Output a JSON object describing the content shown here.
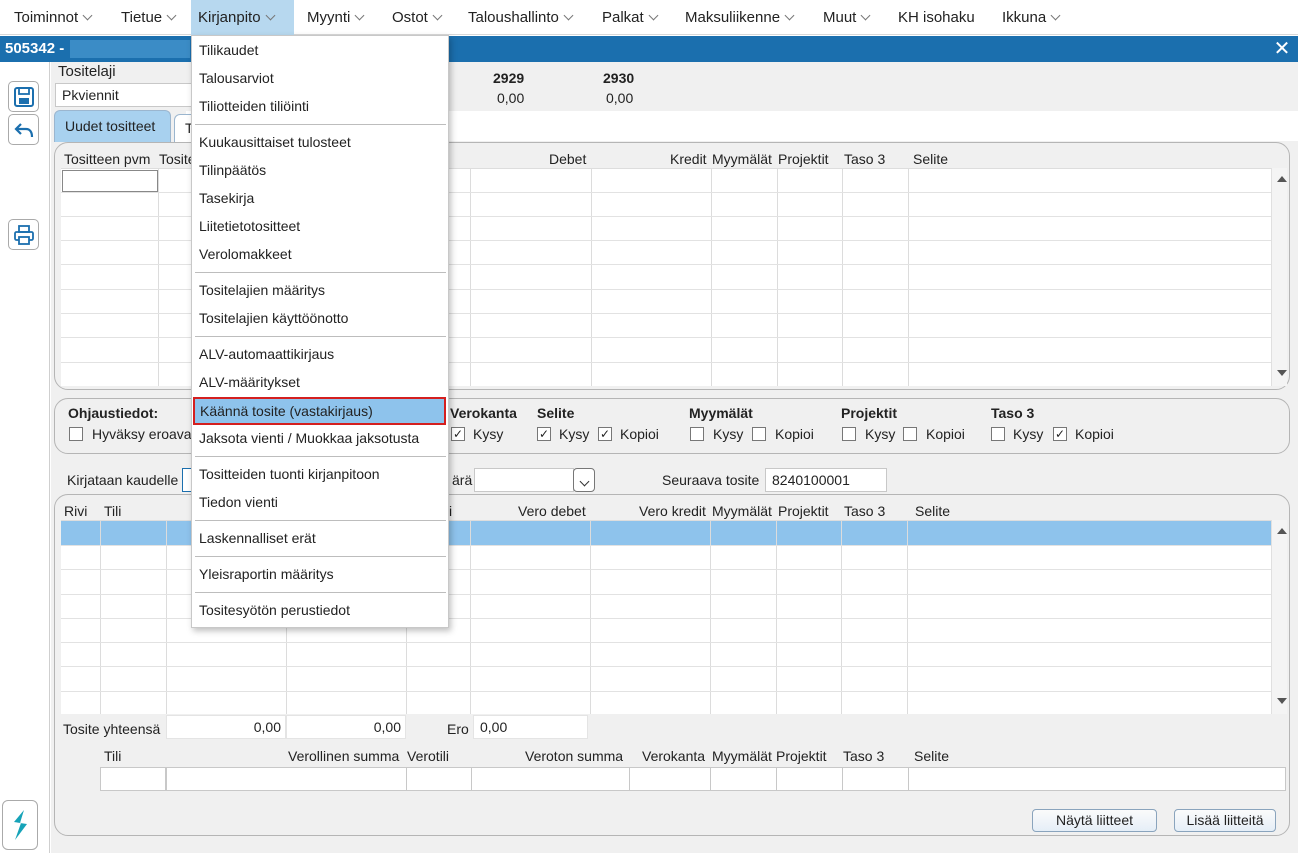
{
  "menubar": {
    "items": [
      "Toiminnot",
      "Tietue",
      "Kirjanpito",
      "Myynti",
      "Ostot",
      "Taloushallinto",
      "Palkat",
      "Maksuliikenne",
      "Muut",
      "KH isohaku",
      "Ikkuna"
    ]
  },
  "window": {
    "title": "505342 -"
  },
  "header": {
    "tositelaji_label": "Tositelaji",
    "tositelaji_value": "Pkviennit",
    "col1_head": "2929",
    "col1_val": "0,00",
    "col2_head": "2930",
    "col2_val": "0,00"
  },
  "tabs": {
    "tab1": "Uudet tositteet",
    "tab2": "T"
  },
  "grid1": {
    "headers": {
      "pvm": "Tositteen pvm",
      "tosite": "Tosite",
      "debet": "Debet",
      "kredit": "Kredit",
      "myymalat": "Myymälät",
      "projektit": "Projektit",
      "taso3": "Taso 3",
      "selite": "Selite"
    }
  },
  "ohjaus": {
    "title": "Ohjaustiedot:",
    "hyvaksy": "Hyväksy eroava",
    "verokanta": "Verokanta",
    "selite": "Selite",
    "myymalat": "Myymälät",
    "projektit": "Projektit",
    "taso3": "Taso 3",
    "kysy": "Kysy",
    "kopioi": "Kopioi"
  },
  "kirjataan": {
    "label": "Kirjataan kaudelle",
    "partial": "ärä",
    "seuraava_label": "Seuraava tosite",
    "seuraava_value": "8240100001"
  },
  "grid2": {
    "headers": {
      "rivi": "Rivi",
      "tili": "Tili",
      "i": "i",
      "vero_debet": "Vero debet",
      "vero_kredit": "Vero kredit",
      "myymalat": "Myymälät",
      "projektit": "Projektit",
      "taso3": "Taso 3",
      "selite": "Selite"
    }
  },
  "totals": {
    "label": "Tosite yhteensä",
    "debet": "0,00",
    "kredit": "0,00",
    "ero_label": "Ero",
    "ero": "0,00"
  },
  "entry": {
    "headers": {
      "tili": "Tili",
      "verollinen": "Verollinen summa",
      "verotili": "Verotili",
      "veroton": "Veroton summa",
      "verokanta": "Verokanta",
      "myymalat": "Myymälät",
      "projektit": "Projektit",
      "taso3": "Taso 3",
      "selite": "Selite"
    }
  },
  "buttons": {
    "nayta": "Näytä liitteet",
    "lisaa": "Lisää liitteitä"
  },
  "dropdown": {
    "items": [
      "Tilikaudet",
      "Talousarviot",
      "Tiliotteiden tiliöinti",
      "Kuukausittaiset tulosteet",
      "Tilinpäätös",
      "Tasekirja",
      "Liitetietotositteet",
      "Verolomakkeet",
      "Tositelajien määritys",
      "Tositelajien käyttöönotto",
      "ALV-automaattikirjaus",
      "ALV-määritykset",
      "Käännä tosite (vastakirjaus)",
      "Jaksota vienti / Muokkaa jaksotusta",
      "Tositteiden tuonti kirjanpitoon",
      "Tiedon vienti",
      "Laskennalliset erät",
      "Yleisraportin määritys",
      "Tositesyötön perustiedot"
    ],
    "selected": "Käännä tosite (vastakirjaus)"
  },
  "colors": {
    "titlebar": "#1b6fae",
    "selection": "#8ec3ec",
    "highlight_border": "#d41f1f",
    "active_menu": "#b7d8ef"
  },
  "icons": [
    "save-icon",
    "undo-icon",
    "print-icon",
    "app-logo-icon",
    "close-icon"
  ]
}
